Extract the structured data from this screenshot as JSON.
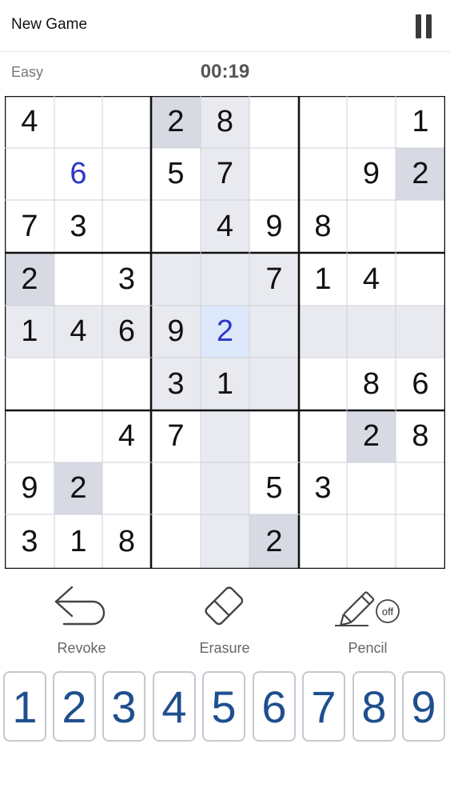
{
  "header": {
    "new_game_label": "New Game"
  },
  "status": {
    "difficulty": "Easy",
    "timer": "00:19"
  },
  "board": {
    "rows": [
      [
        "4",
        "",
        "",
        "2",
        "8",
        "",
        "",
        "",
        "1"
      ],
      [
        "",
        "6",
        "",
        "5",
        "7",
        "",
        "",
        "9",
        "2"
      ],
      [
        "7",
        "3",
        "",
        "",
        "4",
        "9",
        "8",
        "",
        ""
      ],
      [
        "2",
        "",
        "3",
        "",
        "",
        "7",
        "1",
        "4",
        ""
      ],
      [
        "1",
        "4",
        "6",
        "9",
        "2",
        "",
        "",
        "",
        ""
      ],
      [
        "",
        "",
        "",
        "3",
        "1",
        "",
        "",
        "8",
        "6"
      ],
      [
        "",
        "",
        "4",
        "7",
        "",
        "",
        "",
        "2",
        "8"
      ],
      [
        "9",
        "2",
        "",
        "",
        "",
        "5",
        "3",
        "",
        ""
      ],
      [
        "3",
        "1",
        "8",
        "",
        "",
        "2",
        "",
        "",
        ""
      ]
    ],
    "user_entered": [
      [
        1,
        1
      ],
      [
        4,
        4
      ]
    ],
    "selected": [
      4,
      4
    ],
    "same_number_highlight": [
      [
        0,
        3
      ],
      [
        1,
        8
      ],
      [
        3,
        0
      ],
      [
        6,
        7
      ],
      [
        7,
        1
      ],
      [
        8,
        5
      ]
    ],
    "colors": {
      "selected": "#dde8fb",
      "same_number": "#d7d9e3",
      "related": "#e8eaef",
      "user_digit": "#2b37c8",
      "given_digit": "#111111"
    }
  },
  "tools": {
    "revoke_label": "Revoke",
    "erasure_label": "Erasure",
    "pencil_label": "Pencil",
    "pencil_state": "off"
  },
  "numpad": [
    "1",
    "2",
    "3",
    "4",
    "5",
    "6",
    "7",
    "8",
    "9"
  ]
}
